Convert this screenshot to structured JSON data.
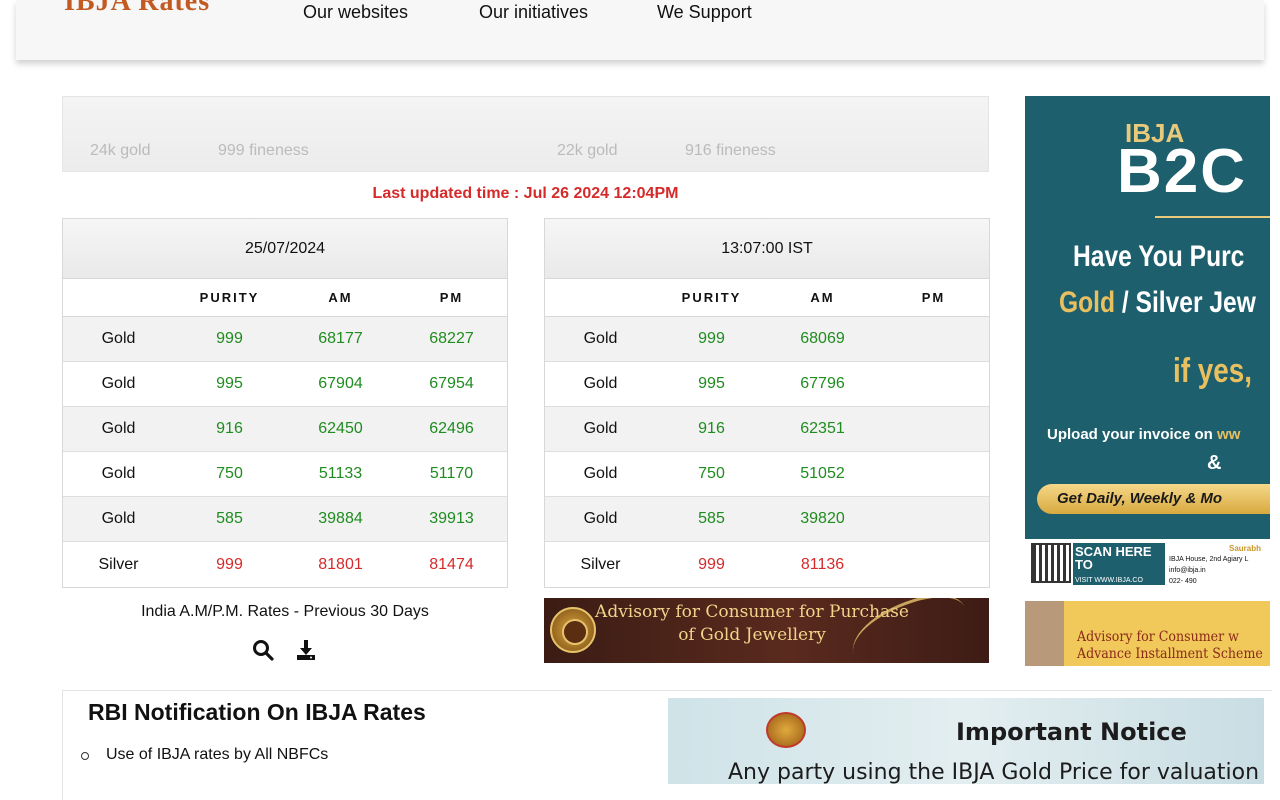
{
  "header": {
    "logo": "IBJA Rates",
    "nav": [
      "Our websites",
      "Our initiatives",
      "We Support"
    ]
  },
  "ticker": {
    "items": [
      {
        "label": "24k gold",
        "fineness": "999 fineness"
      },
      {
        "label": "22k gold",
        "fineness": "916 fineness"
      }
    ]
  },
  "last_updated": "Last updated time : Jul 26 2024 12:04PM",
  "tables": [
    {
      "heading": "25/07/2024",
      "columns": [
        "",
        "PURITY",
        "AM",
        "PM"
      ],
      "rows": [
        {
          "metal": "Gold",
          "purity": "999",
          "am": "68177",
          "pm": "68227"
        },
        {
          "metal": "Gold",
          "purity": "995",
          "am": "67904",
          "pm": "67954"
        },
        {
          "metal": "Gold",
          "purity": "916",
          "am": "62450",
          "pm": "62496"
        },
        {
          "metal": "Gold",
          "purity": "750",
          "am": "51133",
          "pm": "51170"
        },
        {
          "metal": "Gold",
          "purity": "585",
          "am": "39884",
          "pm": "39913"
        },
        {
          "metal": "Silver",
          "purity": "999",
          "am": "81801",
          "pm": "81474"
        }
      ]
    },
    {
      "heading": "13:07:00 IST",
      "columns": [
        "",
        "PURITY",
        "AM",
        "PM"
      ],
      "rows": [
        {
          "metal": "Gold",
          "purity": "999",
          "am": "68069",
          "pm": ""
        },
        {
          "metal": "Gold",
          "purity": "995",
          "am": "67796",
          "pm": ""
        },
        {
          "metal": "Gold",
          "purity": "916",
          "am": "62351",
          "pm": ""
        },
        {
          "metal": "Gold",
          "purity": "750",
          "am": "51052",
          "pm": ""
        },
        {
          "metal": "Gold",
          "purity": "585",
          "am": "39820",
          "pm": ""
        },
        {
          "metal": "Silver",
          "purity": "999",
          "am": "81136",
          "pm": ""
        }
      ]
    }
  ],
  "previous_rates": {
    "label": "India A.M/P.M. Rates - Previous 30 Days",
    "icons": [
      "search-icon",
      "download-icon"
    ]
  },
  "advisory_banner": {
    "line1": "Advisory for Consumer for Purchase",
    "line2": "of Gold Jewellery"
  },
  "sidebar_ad": {
    "logo": "IBJA",
    "brand": "B2C",
    "headline1": "Have You Purc",
    "headline2_gold": "Gold",
    "headline2_rest": " / Silver Jew",
    "yes": "if yes,",
    "upload": "Upload your invoice on ",
    "upload_link": "ww",
    "amp": "&",
    "pill": "Get Daily, Weekly & Mo",
    "scan": "SCAN HERE TO",
    "scan_small": "VISIT WWW.IBJA.CO",
    "contact_name": "Saurabh",
    "address": "IBJA House, 2nd Agiary L",
    "email": "info@ibja.in",
    "phone": "022- 490"
  },
  "sidebar_ad2": {
    "line1": "Advisory for Consumer w",
    "line2": "Advance Installment Scheme"
  },
  "rbi": {
    "title": "RBI Notification On IBJA Rates",
    "items": [
      "Use of IBJA rates by All NBFCs"
    ]
  },
  "notice": {
    "title": "Important Notice",
    "subtitle": "Any party using the IBJA Gold Price for valuation"
  },
  "colors": {
    "green_value": "#1f8c1f",
    "red_value": "#d62a2a",
    "ad_teal": "#1e5f6e",
    "gold": "#e9c060"
  }
}
